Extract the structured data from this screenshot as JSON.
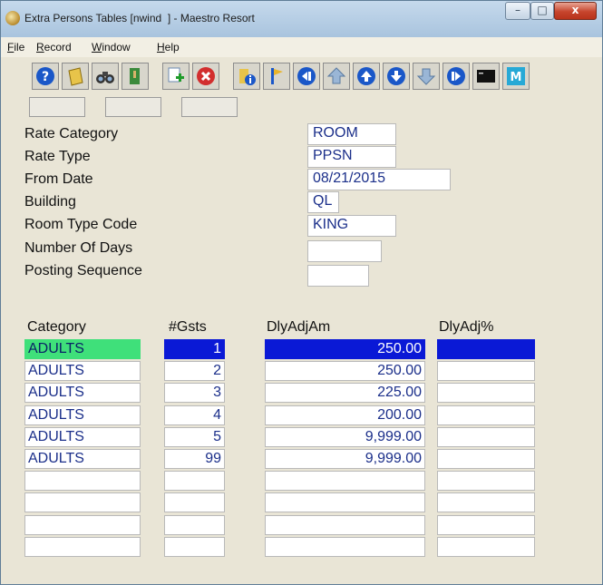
{
  "window": {
    "title": "Extra Persons Tables [nwind  ] - Maestro Resort",
    "controls": {
      "minimize": "–",
      "maximize": "□",
      "close": "x"
    }
  },
  "menu": [
    "File",
    "Record",
    "Window",
    "Help"
  ],
  "toolbar": [
    {
      "name": "help-icon"
    },
    {
      "name": "notepad-icon"
    },
    {
      "name": "binoculars-icon"
    },
    {
      "name": "exit-door-icon"
    },
    {
      "name": "new-record-icon"
    },
    {
      "name": "delete-icon"
    },
    {
      "name": "folder-info-icon"
    },
    {
      "name": "flag-icon"
    },
    {
      "name": "first-record-icon"
    },
    {
      "name": "previous-page-icon"
    },
    {
      "name": "previous-record-icon"
    },
    {
      "name": "next-record-icon"
    },
    {
      "name": "next-page-icon"
    },
    {
      "name": "last-record-icon"
    },
    {
      "name": "console-icon"
    },
    {
      "name": "maestro-icon"
    }
  ],
  "form": {
    "fields": [
      {
        "label": "Rate Category",
        "value": "ROOM"
      },
      {
        "label": "Rate Type",
        "value": "PPSN"
      },
      {
        "label": "From Date",
        "value": "08/21/2015"
      },
      {
        "label": "Building",
        "value": "QL"
      },
      {
        "label": "Room Type Code",
        "value": "KING"
      },
      {
        "label": "Number Of Days",
        "value": ""
      },
      {
        "label": "Posting Sequence",
        "value": ""
      }
    ]
  },
  "grid": {
    "headers": [
      "Category",
      "#Gsts",
      "DlyAdjAm",
      "DlyAdj%"
    ],
    "rows": [
      {
        "category": "ADULTS",
        "gsts": "1",
        "amount": "250.00",
        "pct": ""
      },
      {
        "category": "ADULTS",
        "gsts": "2",
        "amount": "250.00",
        "pct": ""
      },
      {
        "category": "ADULTS",
        "gsts": "3",
        "amount": "225.00",
        "pct": ""
      },
      {
        "category": "ADULTS",
        "gsts": "4",
        "amount": "200.00",
        "pct": ""
      },
      {
        "category": "ADULTS",
        "gsts": "5",
        "amount": "9,999.00",
        "pct": ""
      },
      {
        "category": "ADULTS",
        "gsts": "99",
        "amount": "9,999.00",
        "pct": ""
      },
      {
        "category": "",
        "gsts": "",
        "amount": "",
        "pct": ""
      },
      {
        "category": "",
        "gsts": "",
        "amount": "",
        "pct": ""
      },
      {
        "category": "",
        "gsts": "",
        "amount": "",
        "pct": ""
      },
      {
        "category": "",
        "gsts": "",
        "amount": "",
        "pct": ""
      }
    ]
  },
  "colors": {
    "selected_row": "#0a19d6",
    "focused_cell": "#3fe07a",
    "field_text": "#1b2f8a"
  }
}
